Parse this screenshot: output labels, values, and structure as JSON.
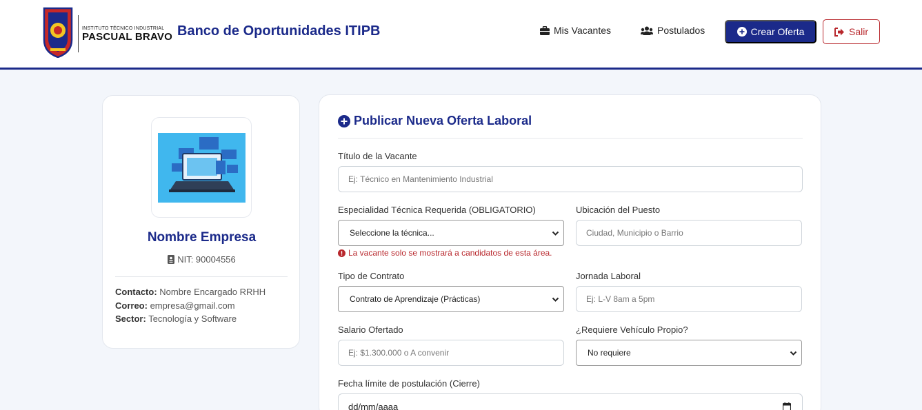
{
  "navbar": {
    "institute_small": "INSTITUTO TÉCNICO INDUSTRIAL",
    "institute_big": "PASCUAL BRAVO",
    "brand_title": "Banco de Oportunidades ITIPB",
    "links": [
      {
        "label": "Mis Vacantes",
        "icon": "briefcase-icon"
      },
      {
        "label": "Postulados",
        "icon": "users-icon"
      }
    ],
    "create_label": "Crear Oferta",
    "logout_label": "Salir",
    "colors": {
      "primary": "#1b2a8a",
      "danger": "#b8272c"
    }
  },
  "profile": {
    "company_name": "Nombre Empresa",
    "nit": "NIT: 90004556",
    "contact_label": "Contacto:",
    "contact_value": "Nombre Encargado RRHH",
    "email_label": "Correo:",
    "email_value": "empresa@gmail.com",
    "sector_label": "Sector:",
    "sector_value": "Tecnología y Software"
  },
  "form": {
    "title": "Publicar Nueva Oferta Laboral",
    "title_label": "Título de la Vacante",
    "title_placeholder": "Ej: Técnico en Mantenimiento Industrial",
    "specialty_label": "Especialidad Técnica Requerida (OBLIGATORIO)",
    "specialty_value": "Seleccione la técnica...",
    "specialty_warning": "La vacante solo se mostrará a candidatos de esta área.",
    "location_label": "Ubicación del Puesto",
    "location_placeholder": "Ciudad, Municipio o Barrio",
    "contract_label": "Tipo de Contrato",
    "contract_value": "Contrato de Aprendizaje (Prácticas)",
    "schedule_label": "Jornada Laboral",
    "schedule_placeholder": "Ej: L-V 8am a 5pm",
    "salary_label": "Salario Ofertado",
    "salary_placeholder": "Ej: $1.300.000 o A convenir",
    "vehicle_label": "¿Requiere Vehículo Propio?",
    "vehicle_value": "No requiere",
    "deadline_label": "Fecha límite de postulación (Cierre)",
    "deadline_value": "dd/mm/aaaa"
  }
}
